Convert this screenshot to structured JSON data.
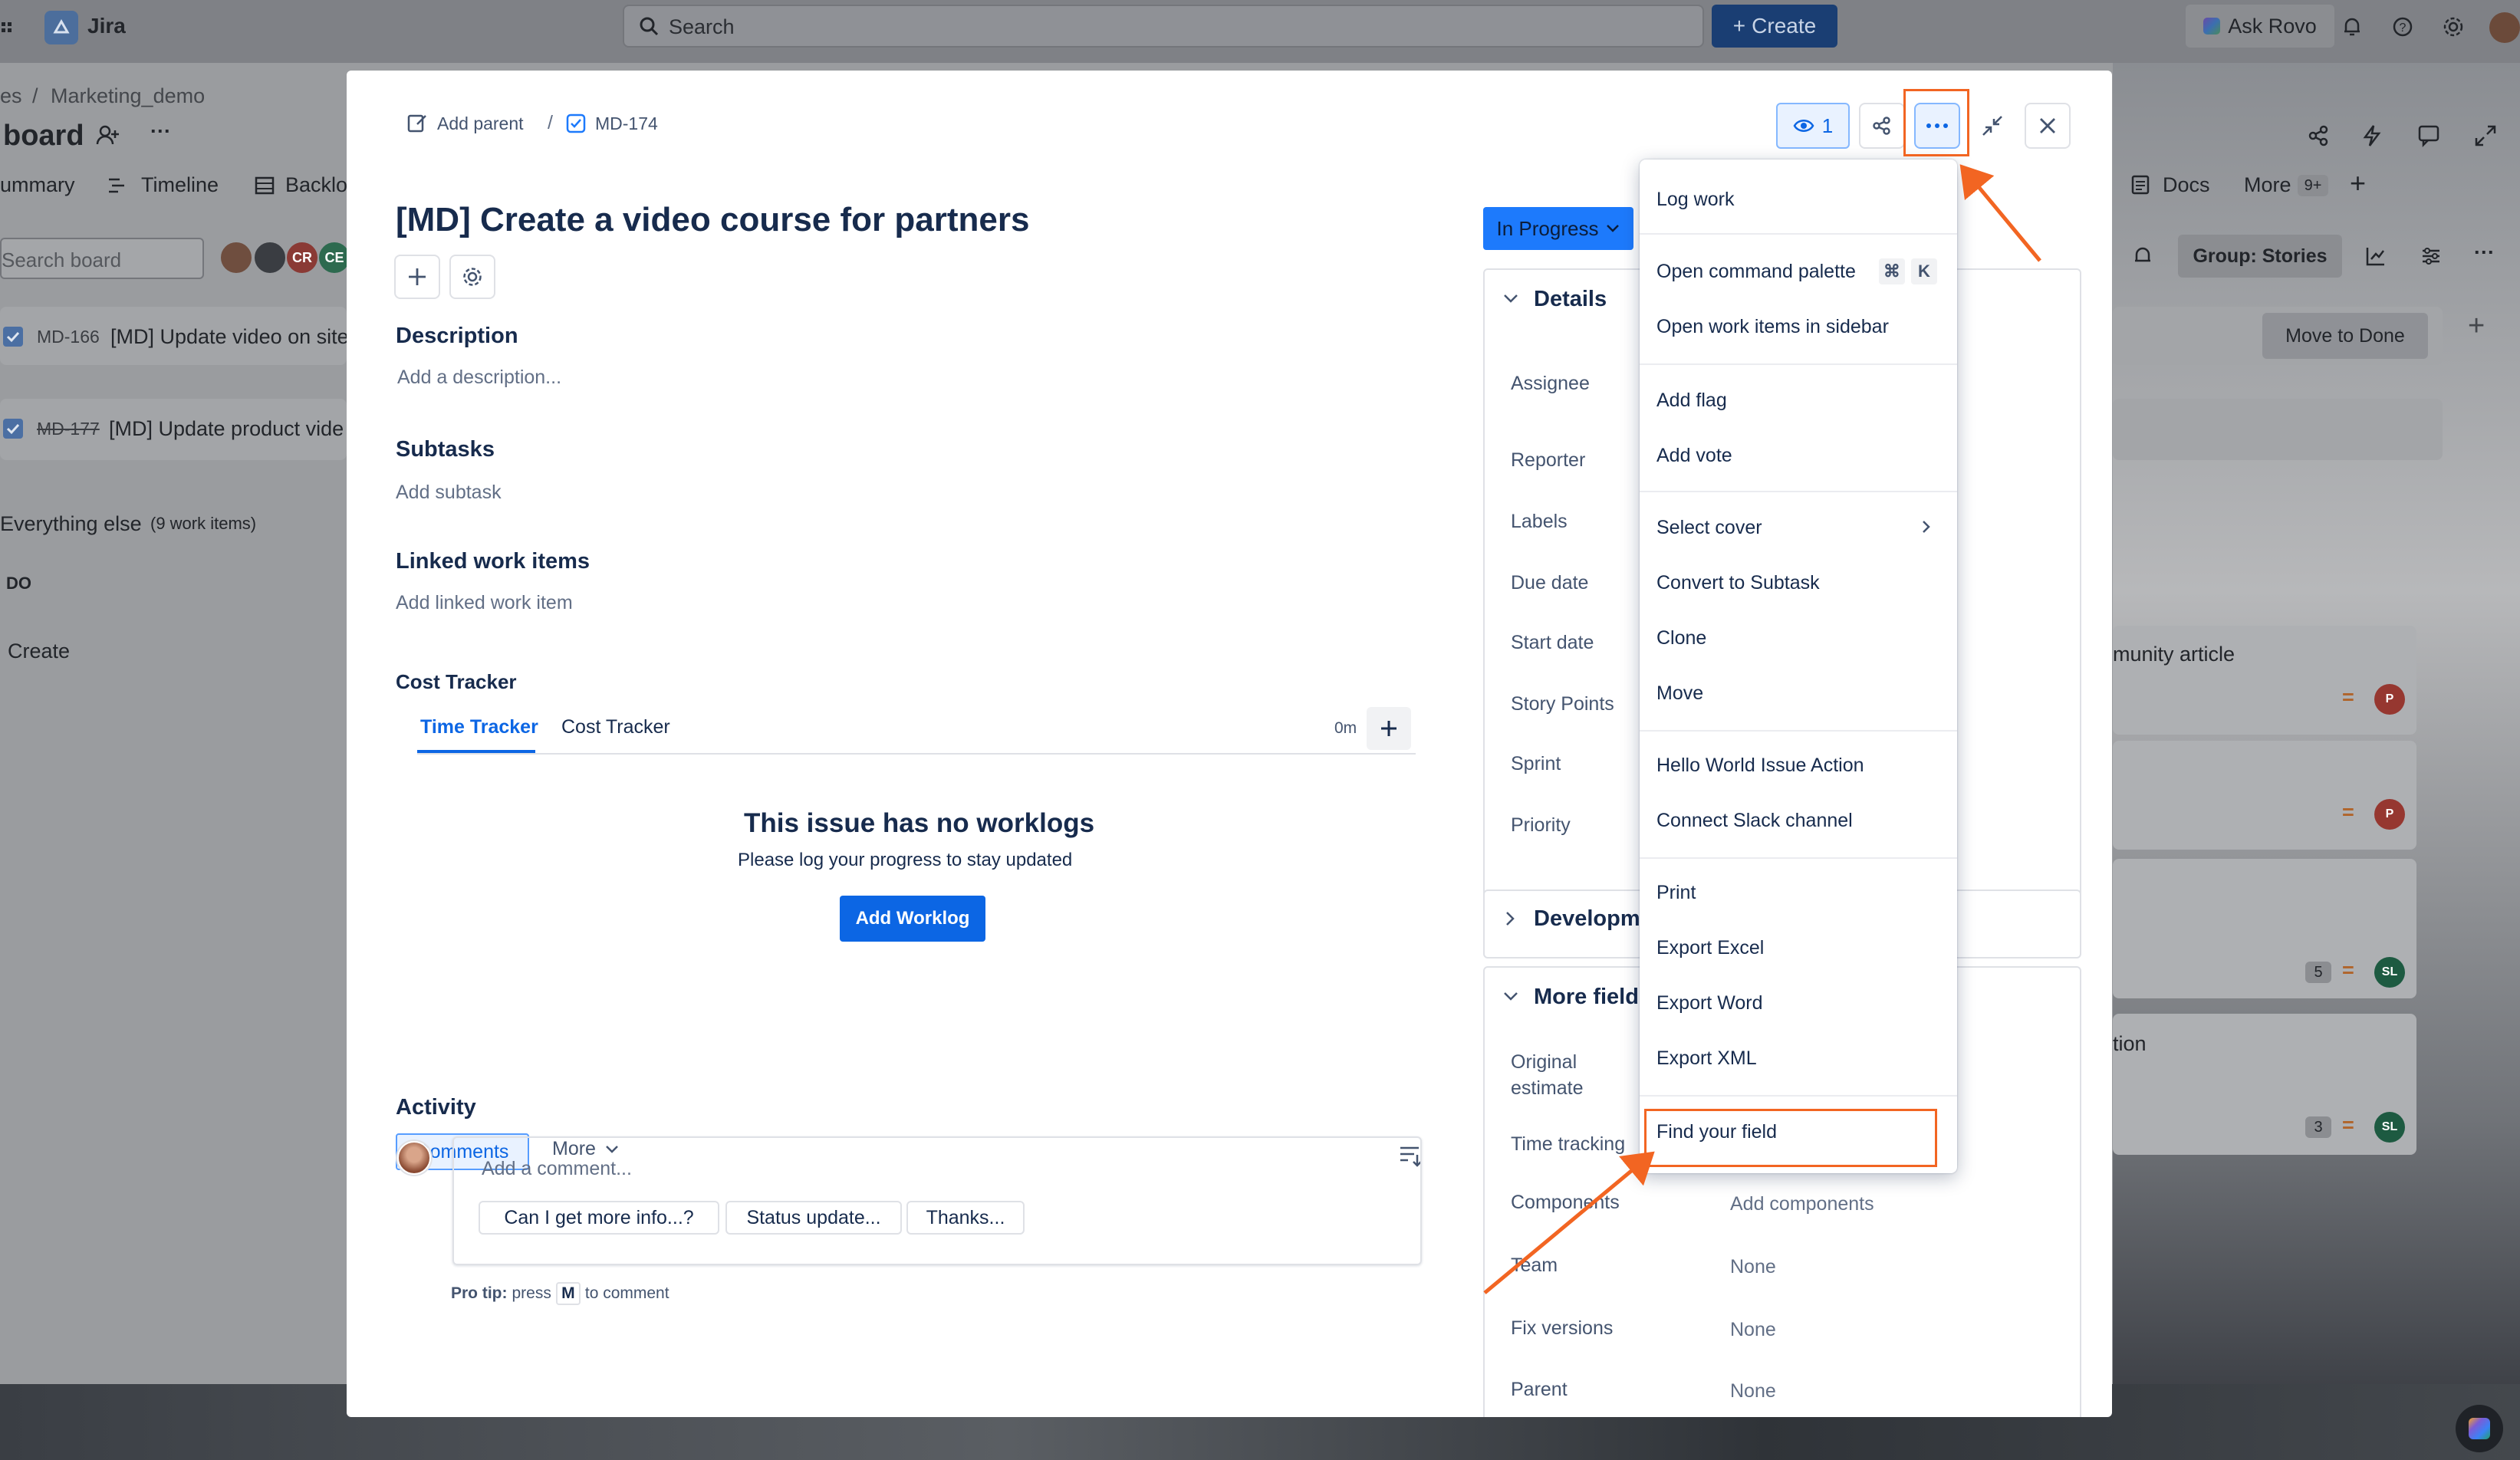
{
  "app": {
    "name": "Jira",
    "search_placeholder": "Search",
    "create_label": "Create",
    "ask_rovo": "Ask Rovo"
  },
  "board_bg": {
    "breadcrumb_partial": "es",
    "breadcrumb_sep": "/",
    "project": "Marketing_demo",
    "title": "board",
    "tabs": [
      "ummary",
      "Timeline",
      "Backlo",
      "Docs",
      "More"
    ],
    "more_count": "9+",
    "search_placeholder": "Search board",
    "avatars": [
      "CR",
      "CE"
    ],
    "group_label": "Group: Stories",
    "move_to_done": "Move to Done",
    "rows": [
      {
        "key": "MD-166",
        "title": "[MD] Update video on site"
      },
      {
        "key": "MD-177",
        "title": "[MD] Update product vide"
      }
    ],
    "everything_else": "Everything else",
    "everything_count": "(9 work items)",
    "todo": "DO",
    "create": "Create",
    "right_cards": [
      {
        "title": "munity article",
        "avatar": "P",
        "avatar_color": "#c9372c"
      },
      {
        "title": "",
        "avatar": "P",
        "avatar_color": "#c9372c"
      },
      {
        "title": "",
        "count": "5",
        "avatar": "SL",
        "avatar_color": "#216e4e"
      },
      {
        "title": "tion",
        "count": "3",
        "avatar": "SL",
        "avatar_color": "#216e4e"
      }
    ]
  },
  "issue": {
    "add_parent": "Add parent",
    "breadcrumb_sep": "/",
    "key": "MD-174",
    "title": "[MD] Create a video course for partners",
    "watch_count": "1",
    "status": "In Progress",
    "description_heading": "Description",
    "description_placeholder": "Add a description...",
    "subtasks_heading": "Subtasks",
    "subtasks_placeholder": "Add subtask",
    "linked_heading": "Linked work items",
    "linked_placeholder": "Add linked work item",
    "cost_tracker_heading": "Cost Tracker",
    "tracker_tabs": [
      "Time Tracker",
      "Cost Tracker"
    ],
    "tracker_time": "0m",
    "no_worklogs_title": "This issue has no worklogs",
    "no_worklogs_sub": "Please log your progress to stay updated",
    "add_worklog": "Add Worklog",
    "activity_heading": "Activity",
    "activity_tabs": [
      "Comments",
      "More"
    ],
    "comment_placeholder": "Add a comment...",
    "quick_replies": [
      "Can I get more info...?",
      "Status update...",
      "Thanks..."
    ],
    "pro_tip_bold": "Pro tip:",
    "pro_tip_text1": "press",
    "pro_tip_key": "M",
    "pro_tip_text2": "to comment"
  },
  "details": {
    "heading": "Details",
    "fields": [
      "Assignee",
      "Reporter",
      "Labels",
      "Due date",
      "Start date",
      "Story Points",
      "Sprint",
      "Priority"
    ],
    "development": "Developm",
    "more_fields": "More field",
    "more": [
      {
        "label": "Original estimate",
        "value": ""
      },
      {
        "label": "Time tracking",
        "value": ""
      },
      {
        "label": "Components",
        "value": "Add components"
      },
      {
        "label": "Team",
        "value": "None"
      },
      {
        "label": "Fix versions",
        "value": "None"
      },
      {
        "label": "Parent",
        "value": "None"
      }
    ]
  },
  "menu": {
    "items": [
      "Log work",
      "Open command palette",
      "Open work items in sidebar",
      "Add flag",
      "Add vote",
      "Select cover",
      "Convert to Subtask",
      "Clone",
      "Move",
      "Hello World Issue Action",
      "Connect Slack channel",
      "Print",
      "Export Excel",
      "Export Word",
      "Export XML",
      "Find your field"
    ],
    "shortcut_keys": [
      "⌘",
      "K"
    ]
  },
  "colors": {
    "accent": "#0c66e4",
    "highlight": "#f26522",
    "status_bg": "#1d7afc"
  }
}
